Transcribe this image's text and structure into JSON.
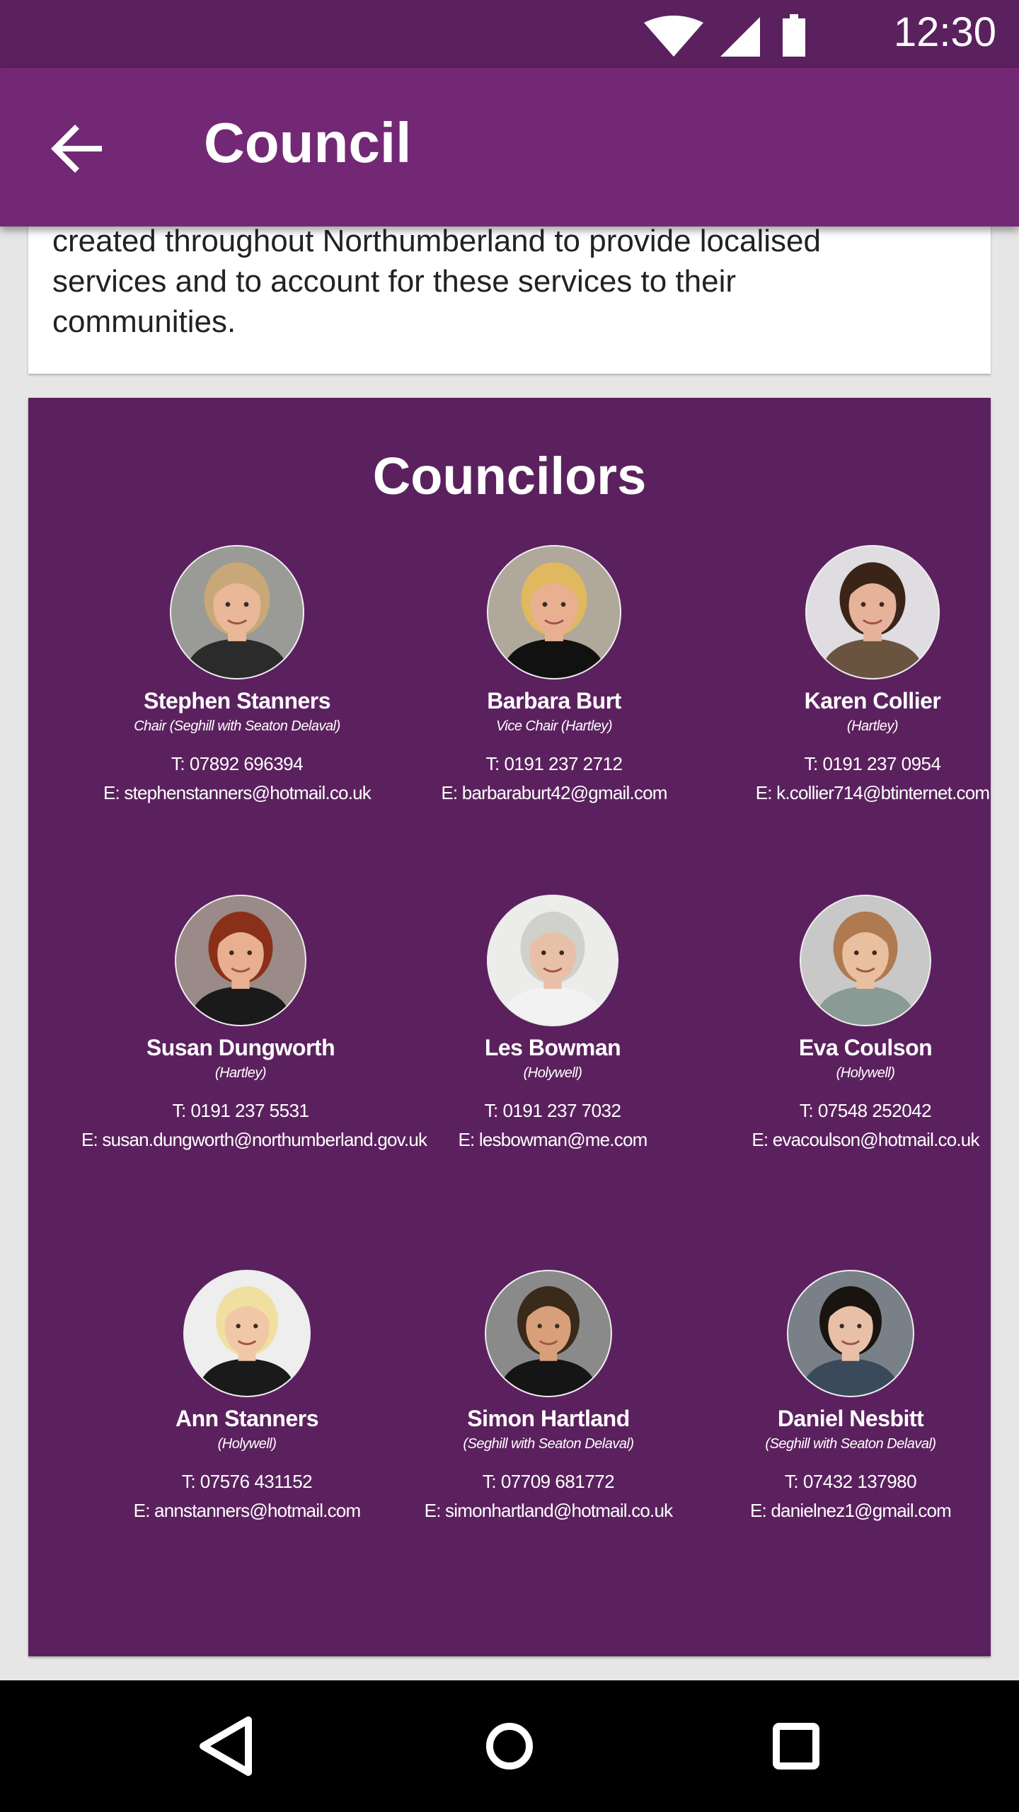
{
  "status_bar": {
    "time": "12:30",
    "icons": [
      "wifi-icon",
      "cell-signal-icon",
      "battery-icon"
    ]
  },
  "app_bar": {
    "title": "Council",
    "back_icon": "arrow-back-icon"
  },
  "intro": {
    "lines": [
      "created throughout Northumberland to provide localised",
      "services and to account for these services to their",
      "communities."
    ]
  },
  "councillors": {
    "heading": "Councilors",
    "members": [
      {
        "name": "Stephen Stanners",
        "ward": "Chair (Seghill with Seaton Delaval)",
        "phone": "T: 07892 696394",
        "email": "E: stephenstanners@hotmail.co.uk",
        "skin": "#e8b898",
        "hair": "#c8a878",
        "top": "#2b2b2b",
        "bg": "#9a9a96"
      },
      {
        "name": "Barbara Burt",
        "ward": "Vice Chair (Hartley)",
        "phone": "T: 0191 237 2712",
        "email": "E: barbaraburt42@gmail.com",
        "skin": "#e8b090",
        "hair": "#e0b860",
        "top": "#111111",
        "bg": "#b0a89a"
      },
      {
        "name": "Karen Collier",
        "ward": "(Hartley)",
        "phone": "T: 0191 237 0954",
        "email": "E: k.collier714@btinternet.com",
        "skin": "#e6b29a",
        "hair": "#3a2418",
        "top": "#6a5440",
        "bg": "#e0dde2"
      },
      {
        "name": "Susan Dungworth",
        "ward": "(Hartley)",
        "phone": "T: 0191 237 5531",
        "email": "E: susan.dungworth@northumberland.gov.uk",
        "skin": "#e8b090",
        "hair": "#8a3018",
        "top": "#1a1a1a",
        "bg": "#9a8a88"
      },
      {
        "name": "Les Bowman",
        "ward": "(Holywell)",
        "phone": "T: 0191 237 7032",
        "email": "E: lesbowman@me.com",
        "skin": "#e8c0a8",
        "hair": "#d0d0cc",
        "top": "#f2f2f2",
        "bg": "#ececea"
      },
      {
        "name": "Eva Coulson",
        "ward": "(Holywell)",
        "phone": "T: 07548 252042",
        "email": "E: evacoulson@hotmail.co.uk",
        "skin": "#e8c0a0",
        "hair": "#b07a50",
        "top": "#8a9a94",
        "bg": "#c8c8c8"
      },
      {
        "name": "Ann Stanners",
        "ward": "(Holywell)",
        "phone": "T: 07576 431152",
        "email": "E: annstanners@hotmail.com",
        "skin": "#f0c8a8",
        "hair": "#f0e0a0",
        "top": "#1a1a1a",
        "bg": "#eeeeee"
      },
      {
        "name": "Simon Hartland",
        "ward": "(Seghill with Seaton Delaval)",
        "phone": "T: 07709 681772",
        "email": "E: simonhartland@hotmail.co.uk",
        "skin": "#d8a07a",
        "hair": "#3a2a1a",
        "top": "#151515",
        "bg": "#8a8a8a"
      },
      {
        "name": "Daniel Nesbitt",
        "ward": "(Seghill with Seaton Delaval)",
        "phone": "T: 07432 137980",
        "email": "E: danielnez1@gmail.com",
        "skin": "#e8c0a8",
        "hair": "#1a1410",
        "top": "#3a4a5a",
        "bg": "#7a8088"
      }
    ]
  },
  "nav_bar": {
    "buttons": [
      "back-triangle-icon",
      "home-circle-icon",
      "recents-square-icon"
    ]
  }
}
